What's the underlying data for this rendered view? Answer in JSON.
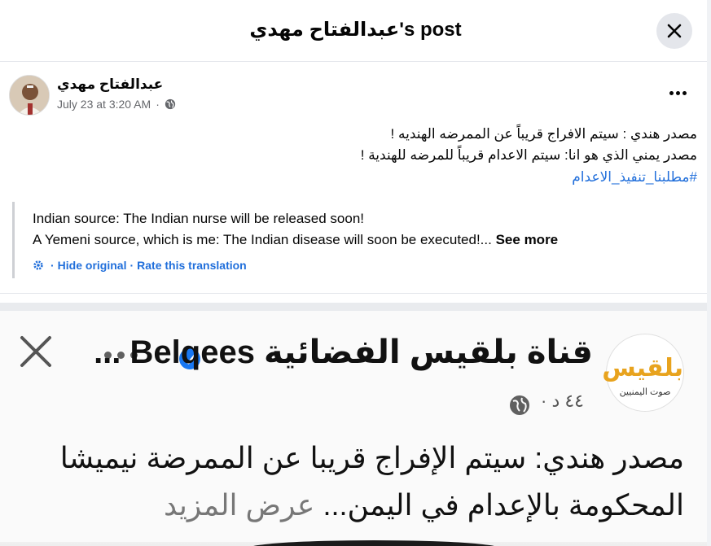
{
  "header": {
    "title": "عبدالفتاح مهدي's post"
  },
  "post": {
    "author": "عبدالفتاح مهدي",
    "timestamp": "July 23 at 3:20 AM",
    "privacy_icon": "globe-icon",
    "text_lines": [
      "مصدر هندي : سيتم الافراج قريباً عن الممرضه الهنديه !",
      "مصدر يمني الذي هو انا:  سيتم الاعدام قريباً للمرضه   للهندية !"
    ],
    "hashtag": "#مطلبنا_تنفيذ_الاعدام"
  },
  "translation": {
    "line1": "Indian source: The Indian nurse will be released soon!",
    "line2": "A Yemeni source, which is me: The Indian disease will soon be executed!...",
    "see_more": "See more",
    "hide_original": "Hide original",
    "rate_translation": "Rate this translation",
    "separator": "·"
  },
  "media": {
    "channel_name": "قناة بلقيس الفضائية Belqees ...",
    "logo_text": "بلقيس",
    "logo_subtext": "صوت اليمنيين",
    "time": "٤٤ د ·",
    "text_line1": "مصدر هندي: سيتم الإفراج قريبا عن الممرضة نيميشا",
    "text_line2": "المحكومة بالإعدام في اليمن...",
    "see_more": "عرض المزيد"
  },
  "colors": {
    "link_blue": "#216fdb",
    "meta_gray": "#65676b",
    "divider": "#e4e6eb",
    "verified_blue": "#1877f2",
    "logo_gold": "#e8a31e"
  }
}
